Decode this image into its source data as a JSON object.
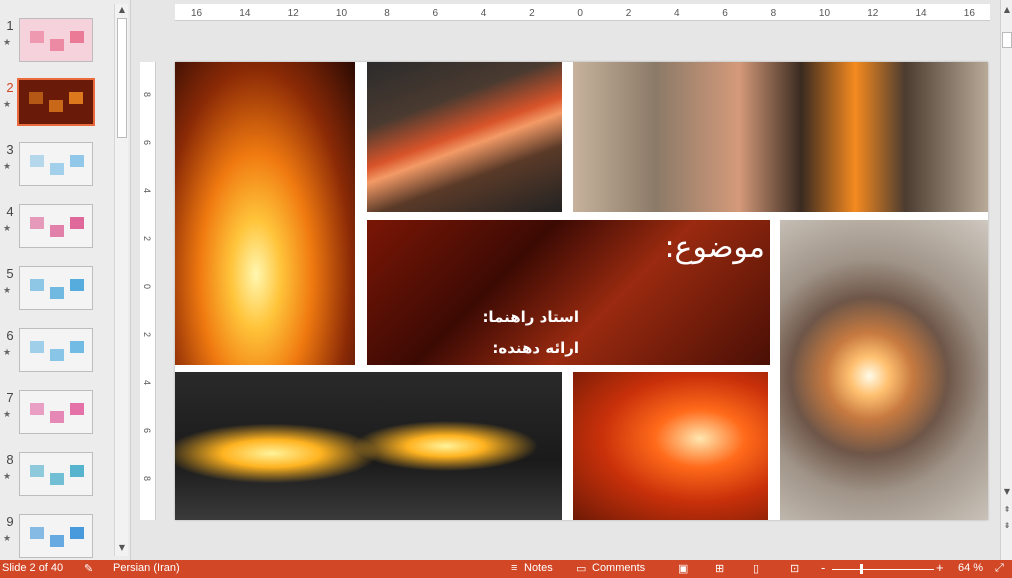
{
  "thumbnails": [
    {
      "num": "1",
      "colors": [
        "#f6d3dc",
        "#e86a8a"
      ]
    },
    {
      "num": "2",
      "colors": [
        "#6a1a08",
        "#f28a20"
      ],
      "active": true
    },
    {
      "num": "3",
      "colors": [
        "#f4f4f4",
        "#7fbfe6"
      ]
    },
    {
      "num": "4",
      "colors": [
        "#f4f4f4",
        "#d9508a"
      ]
    },
    {
      "num": "5",
      "colors": [
        "#f4f4f4",
        "#3aa0d8"
      ]
    },
    {
      "num": "6",
      "colors": [
        "#f4f4f4",
        "#5bb0e0"
      ]
    },
    {
      "num": "7",
      "colors": [
        "#f4f4f4",
        "#e05a9a"
      ]
    },
    {
      "num": "8",
      "colors": [
        "#f4f4f4",
        "#3aa8c8"
      ]
    },
    {
      "num": "9",
      "colors": [
        "#f4f4f4",
        "#2a8ad8"
      ]
    }
  ],
  "thumb_star": "★",
  "accent_color": "#d24726",
  "hruler_ticks": [
    "16",
    "14",
    "12",
    "10",
    "8",
    "6",
    "4",
    "2",
    "0",
    "2",
    "4",
    "6",
    "8",
    "10",
    "12",
    "14",
    "16"
  ],
  "vruler_ticks": [
    "8",
    "6",
    "4",
    "2",
    "0",
    "2",
    "4",
    "6",
    "8"
  ],
  "slide": {
    "title": "موضوع:",
    "advisor": "استاد راهنما:",
    "presenter": "ارائه دهنده:"
  },
  "status": {
    "slide_info": "Slide 2 of 40",
    "language": "Persian (Iran)",
    "notes": "Notes",
    "comments": "Comments",
    "zoom": "64 %",
    "zoom_minus": "-",
    "zoom_plus": "+"
  }
}
